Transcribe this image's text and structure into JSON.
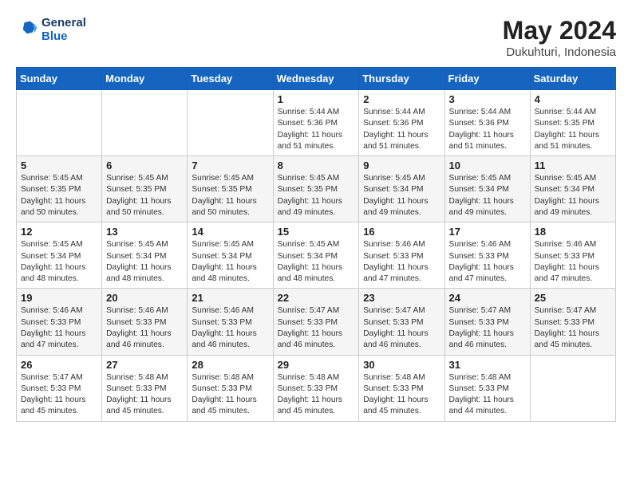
{
  "header": {
    "logo_line1": "General",
    "logo_line2": "Blue",
    "title": "May 2024",
    "subtitle": "Dukuhturi, Indonesia"
  },
  "weekdays": [
    "Sunday",
    "Monday",
    "Tuesday",
    "Wednesday",
    "Thursday",
    "Friday",
    "Saturday"
  ],
  "weeks": [
    [
      {
        "day": "",
        "info": ""
      },
      {
        "day": "",
        "info": ""
      },
      {
        "day": "",
        "info": ""
      },
      {
        "day": "1",
        "info": "Sunrise: 5:44 AM\nSunset: 5:36 PM\nDaylight: 11 hours\nand 51 minutes."
      },
      {
        "day": "2",
        "info": "Sunrise: 5:44 AM\nSunset: 5:36 PM\nDaylight: 11 hours\nand 51 minutes."
      },
      {
        "day": "3",
        "info": "Sunrise: 5:44 AM\nSunset: 5:36 PM\nDaylight: 11 hours\nand 51 minutes."
      },
      {
        "day": "4",
        "info": "Sunrise: 5:44 AM\nSunset: 5:35 PM\nDaylight: 11 hours\nand 51 minutes."
      }
    ],
    [
      {
        "day": "5",
        "info": "Sunrise: 5:45 AM\nSunset: 5:35 PM\nDaylight: 11 hours\nand 50 minutes."
      },
      {
        "day": "6",
        "info": "Sunrise: 5:45 AM\nSunset: 5:35 PM\nDaylight: 11 hours\nand 50 minutes."
      },
      {
        "day": "7",
        "info": "Sunrise: 5:45 AM\nSunset: 5:35 PM\nDaylight: 11 hours\nand 50 minutes."
      },
      {
        "day": "8",
        "info": "Sunrise: 5:45 AM\nSunset: 5:35 PM\nDaylight: 11 hours\nand 49 minutes."
      },
      {
        "day": "9",
        "info": "Sunrise: 5:45 AM\nSunset: 5:34 PM\nDaylight: 11 hours\nand 49 minutes."
      },
      {
        "day": "10",
        "info": "Sunrise: 5:45 AM\nSunset: 5:34 PM\nDaylight: 11 hours\nand 49 minutes."
      },
      {
        "day": "11",
        "info": "Sunrise: 5:45 AM\nSunset: 5:34 PM\nDaylight: 11 hours\nand 49 minutes."
      }
    ],
    [
      {
        "day": "12",
        "info": "Sunrise: 5:45 AM\nSunset: 5:34 PM\nDaylight: 11 hours\nand 48 minutes."
      },
      {
        "day": "13",
        "info": "Sunrise: 5:45 AM\nSunset: 5:34 PM\nDaylight: 11 hours\nand 48 minutes."
      },
      {
        "day": "14",
        "info": "Sunrise: 5:45 AM\nSunset: 5:34 PM\nDaylight: 11 hours\nand 48 minutes."
      },
      {
        "day": "15",
        "info": "Sunrise: 5:45 AM\nSunset: 5:34 PM\nDaylight: 11 hours\nand 48 minutes."
      },
      {
        "day": "16",
        "info": "Sunrise: 5:46 AM\nSunset: 5:33 PM\nDaylight: 11 hours\nand 47 minutes."
      },
      {
        "day": "17",
        "info": "Sunrise: 5:46 AM\nSunset: 5:33 PM\nDaylight: 11 hours\nand 47 minutes."
      },
      {
        "day": "18",
        "info": "Sunrise: 5:46 AM\nSunset: 5:33 PM\nDaylight: 11 hours\nand 47 minutes."
      }
    ],
    [
      {
        "day": "19",
        "info": "Sunrise: 5:46 AM\nSunset: 5:33 PM\nDaylight: 11 hours\nand 47 minutes."
      },
      {
        "day": "20",
        "info": "Sunrise: 5:46 AM\nSunset: 5:33 PM\nDaylight: 11 hours\nand 46 minutes."
      },
      {
        "day": "21",
        "info": "Sunrise: 5:46 AM\nSunset: 5:33 PM\nDaylight: 11 hours\nand 46 minutes."
      },
      {
        "day": "22",
        "info": "Sunrise: 5:47 AM\nSunset: 5:33 PM\nDaylight: 11 hours\nand 46 minutes."
      },
      {
        "day": "23",
        "info": "Sunrise: 5:47 AM\nSunset: 5:33 PM\nDaylight: 11 hours\nand 46 minutes."
      },
      {
        "day": "24",
        "info": "Sunrise: 5:47 AM\nSunset: 5:33 PM\nDaylight: 11 hours\nand 46 minutes."
      },
      {
        "day": "25",
        "info": "Sunrise: 5:47 AM\nSunset: 5:33 PM\nDaylight: 11 hours\nand 45 minutes."
      }
    ],
    [
      {
        "day": "26",
        "info": "Sunrise: 5:47 AM\nSunset: 5:33 PM\nDaylight: 11 hours\nand 45 minutes."
      },
      {
        "day": "27",
        "info": "Sunrise: 5:48 AM\nSunset: 5:33 PM\nDaylight: 11 hours\nand 45 minutes."
      },
      {
        "day": "28",
        "info": "Sunrise: 5:48 AM\nSunset: 5:33 PM\nDaylight: 11 hours\nand 45 minutes."
      },
      {
        "day": "29",
        "info": "Sunrise: 5:48 AM\nSunset: 5:33 PM\nDaylight: 11 hours\nand 45 minutes."
      },
      {
        "day": "30",
        "info": "Sunrise: 5:48 AM\nSunset: 5:33 PM\nDaylight: 11 hours\nand 45 minutes."
      },
      {
        "day": "31",
        "info": "Sunrise: 5:48 AM\nSunset: 5:33 PM\nDaylight: 11 hours\nand 44 minutes."
      },
      {
        "day": "",
        "info": ""
      }
    ]
  ]
}
